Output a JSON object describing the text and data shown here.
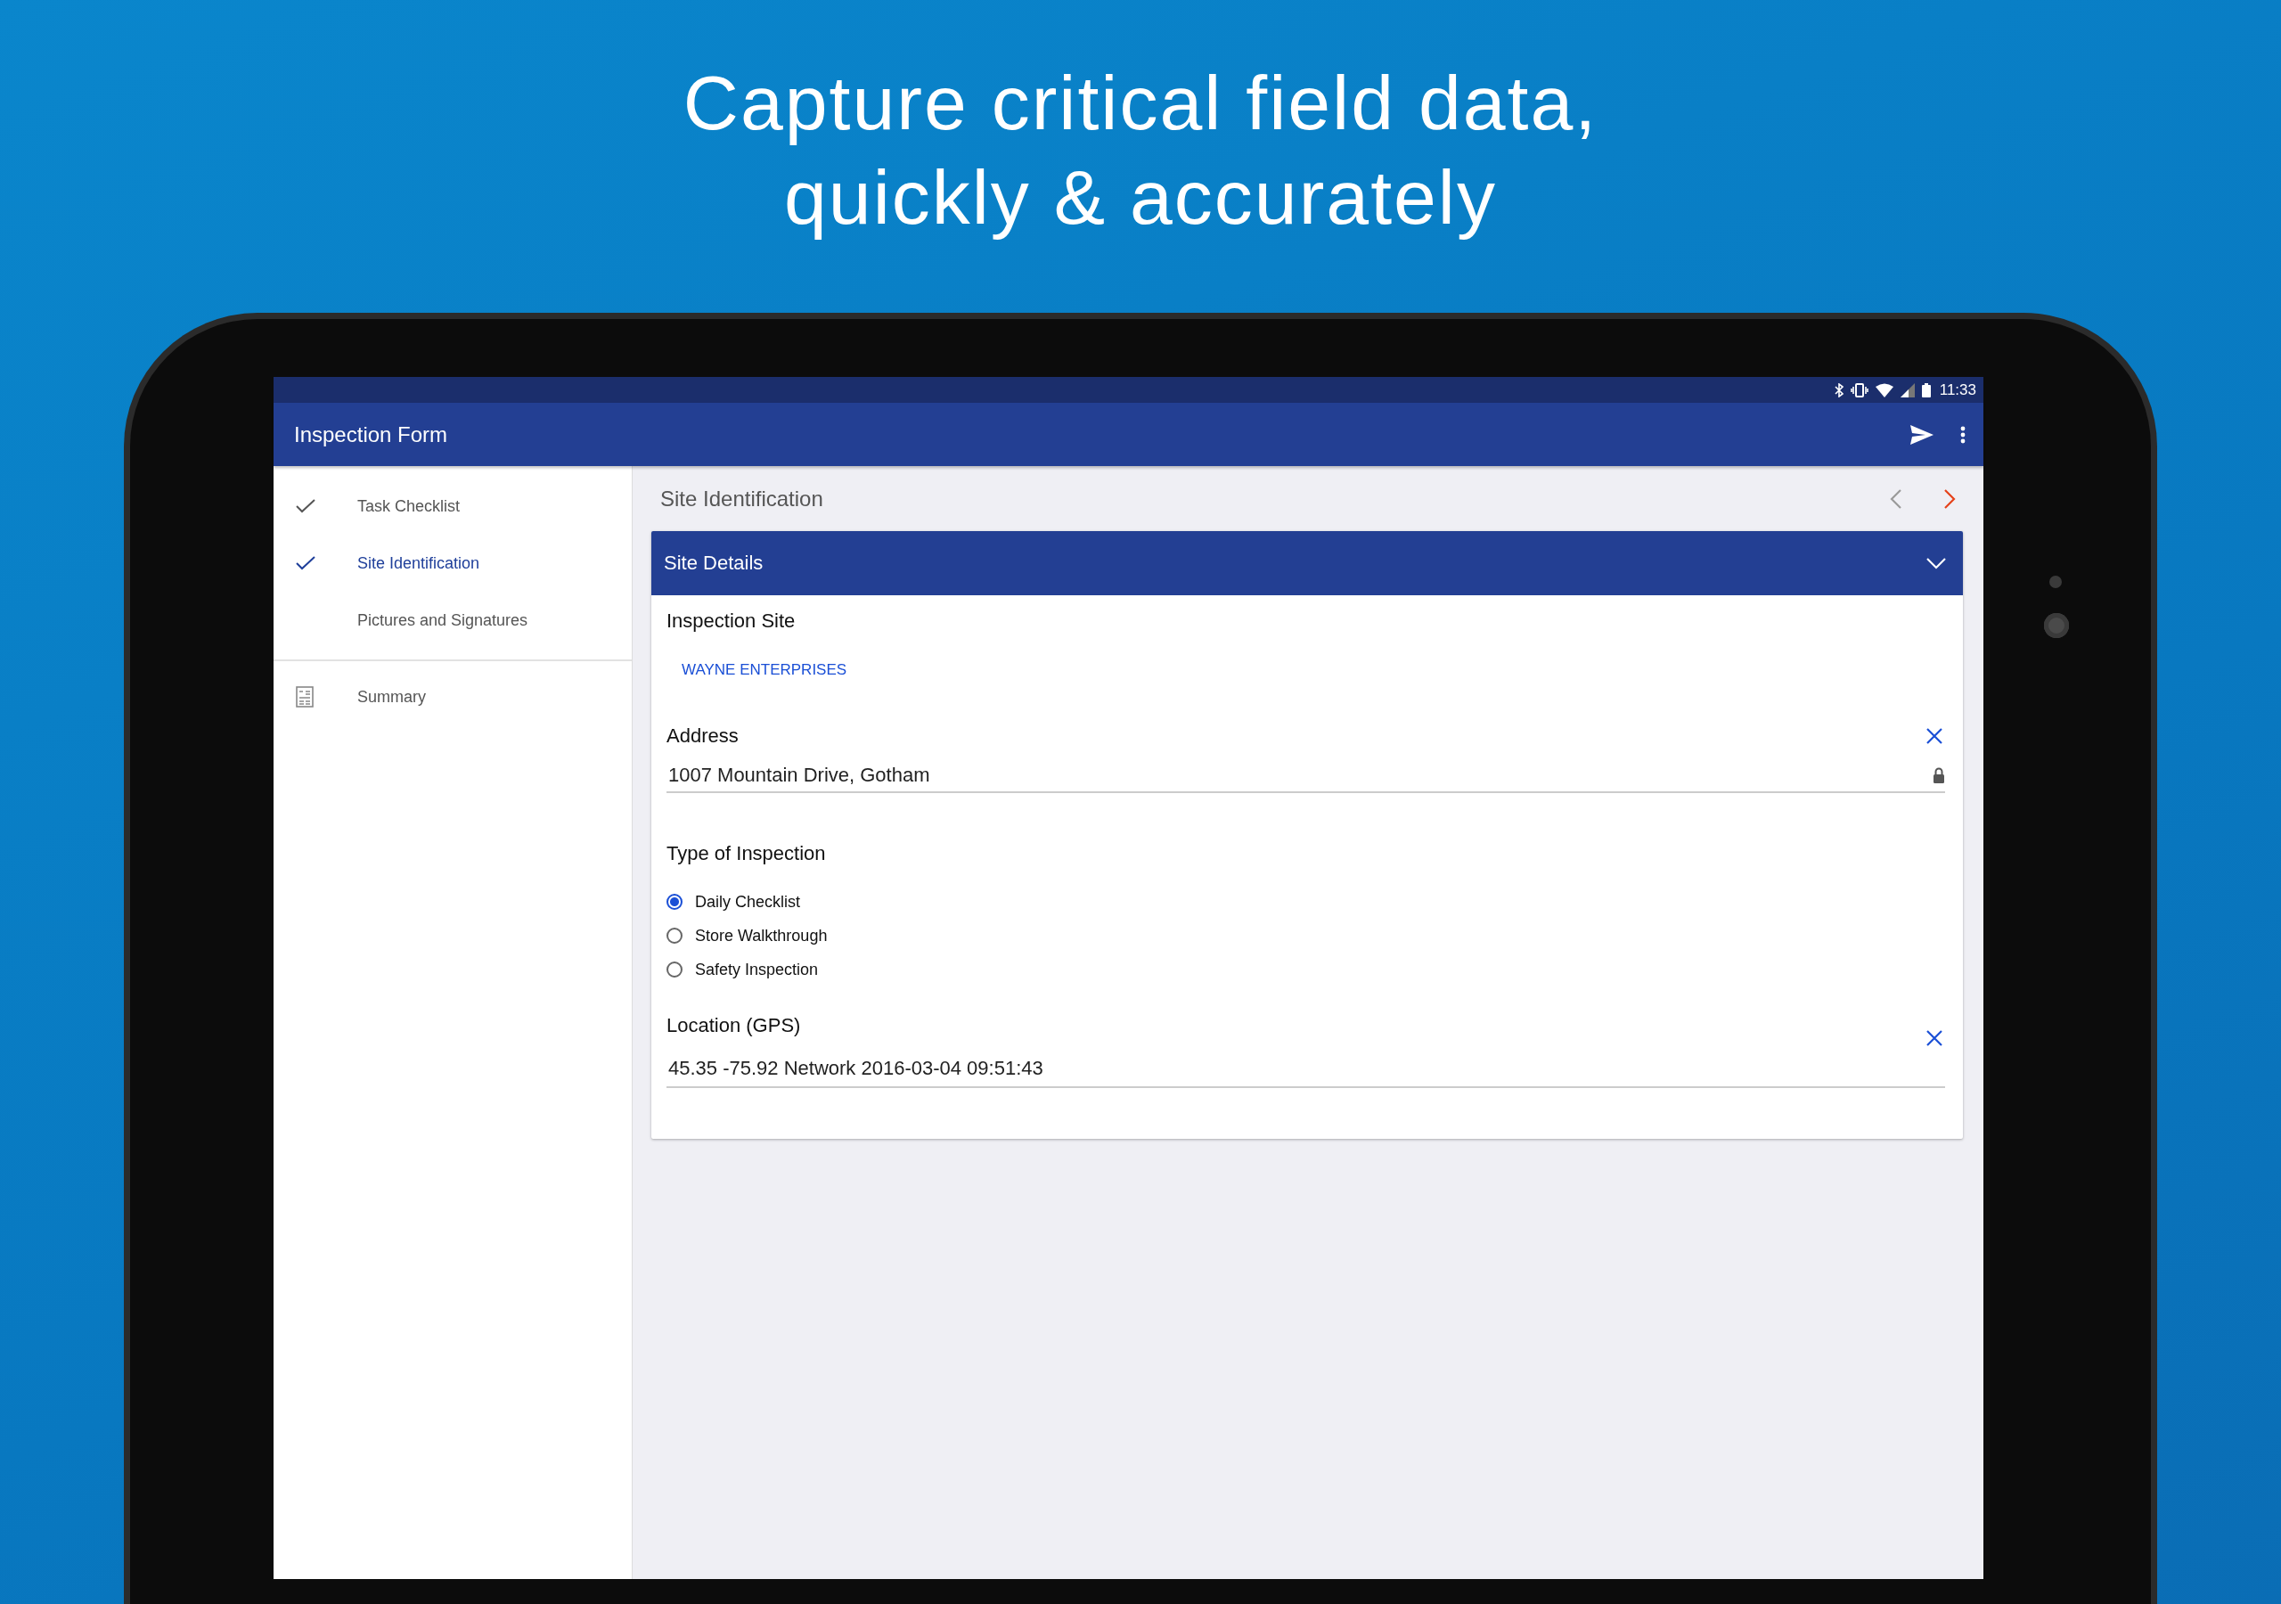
{
  "headline": "Capture critical field data, quickly & accurately",
  "status_bar": {
    "time": "11:33"
  },
  "toolbar": {
    "title": "Inspection Form"
  },
  "sidebar": {
    "items": [
      {
        "label": "Task Checklist",
        "checked": true,
        "selected": false
      },
      {
        "label": "Site Identification",
        "checked": true,
        "selected": true
      },
      {
        "label": "Pictures and Signatures",
        "checked": false,
        "selected": false
      }
    ],
    "summary": {
      "label": "Summary",
      "selected": false
    }
  },
  "main": {
    "title": "Site Identification",
    "previous": {
      "disabled": true
    },
    "next": {
      "disabled": false
    }
  },
  "card": {
    "title": "Site Details",
    "expanded": true,
    "fields": [
      {
        "kind": "link",
        "label": "Inspection Site",
        "value": "WAYNE ENTERPRISES"
      },
      {
        "kind": "text",
        "label": "Address",
        "value": "1007 Mountain Drive, Gotham",
        "clearable": true,
        "locked": true
      },
      {
        "kind": "radio",
        "label": "Type of Inspection",
        "options": [
          {
            "label": "Daily Checklist",
            "selected": true
          },
          {
            "label": "Store Walkthrough",
            "selected": false
          },
          {
            "label": "Safety Inspection",
            "selected": false
          }
        ]
      },
      {
        "kind": "text",
        "label": "Location (GPS)",
        "value": "45.35 -75.92 Network 2016-03-04 09:51:43",
        "clearable": true,
        "locked": false
      }
    ]
  }
}
